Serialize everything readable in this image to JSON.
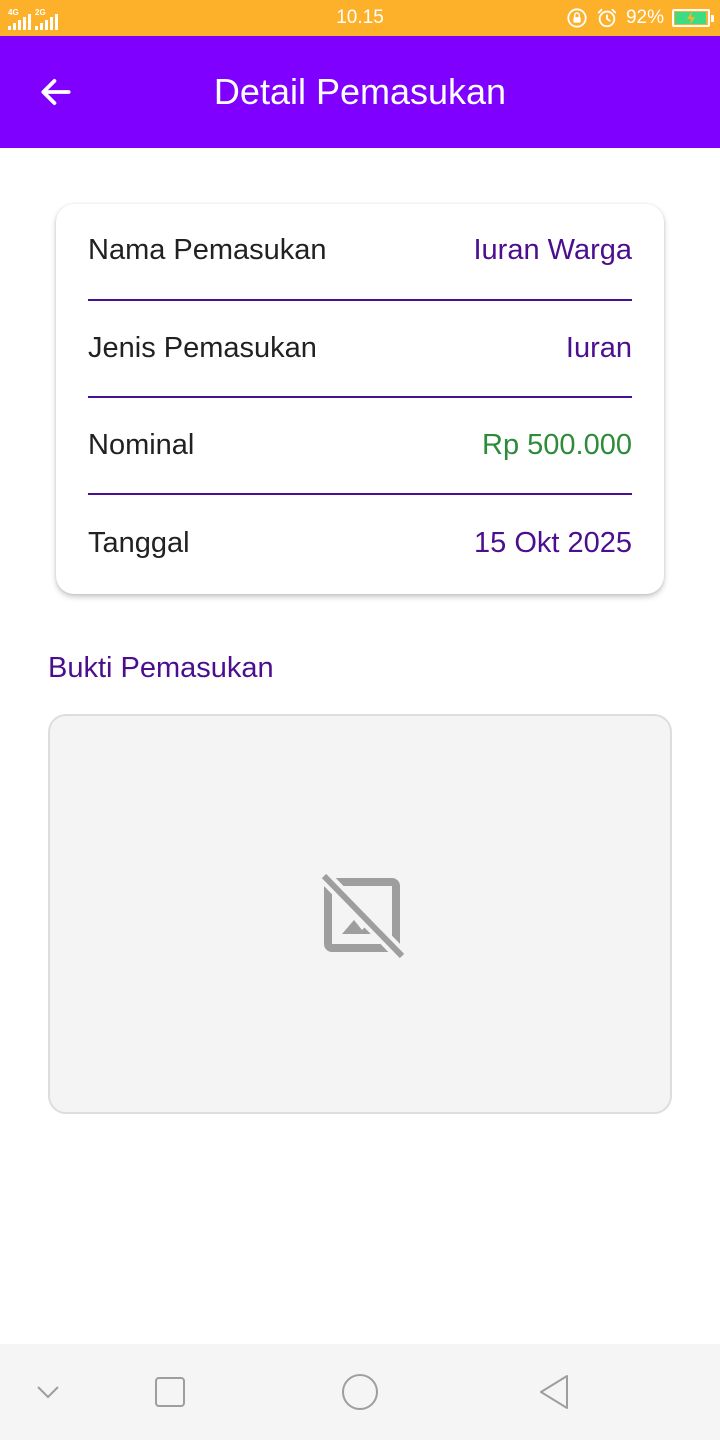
{
  "status_bar": {
    "network_1": "4G",
    "network_2": "2G",
    "time": "10.15",
    "battery_percent": "92%",
    "icons": [
      "rotation-lock-icon",
      "alarm-icon",
      "battery-charging-icon"
    ],
    "color": "#FDB12A"
  },
  "app_bar": {
    "title": "Detail Pemasukan",
    "back_icon": "arrow-left-icon",
    "color": "#8000FF"
  },
  "details": {
    "rows": [
      {
        "label": "Nama Pemasukan",
        "value": "Iuran Warga"
      },
      {
        "label": "Jenis Pemasukan",
        "value": "Iuran"
      },
      {
        "label": "Nominal",
        "value": "Rp 500.000"
      },
      {
        "label": "Tanggal",
        "value": "15 Okt 2025"
      }
    ],
    "accent_color": "#4A0E8F",
    "amount_color": "#2E8B3A"
  },
  "proof": {
    "title": "Bukti Pemasukan",
    "placeholder_icon": "broken-image-icon"
  },
  "nav_bar": {
    "icons": [
      "chevron-down-icon",
      "recents-icon",
      "home-icon",
      "back-icon"
    ]
  }
}
